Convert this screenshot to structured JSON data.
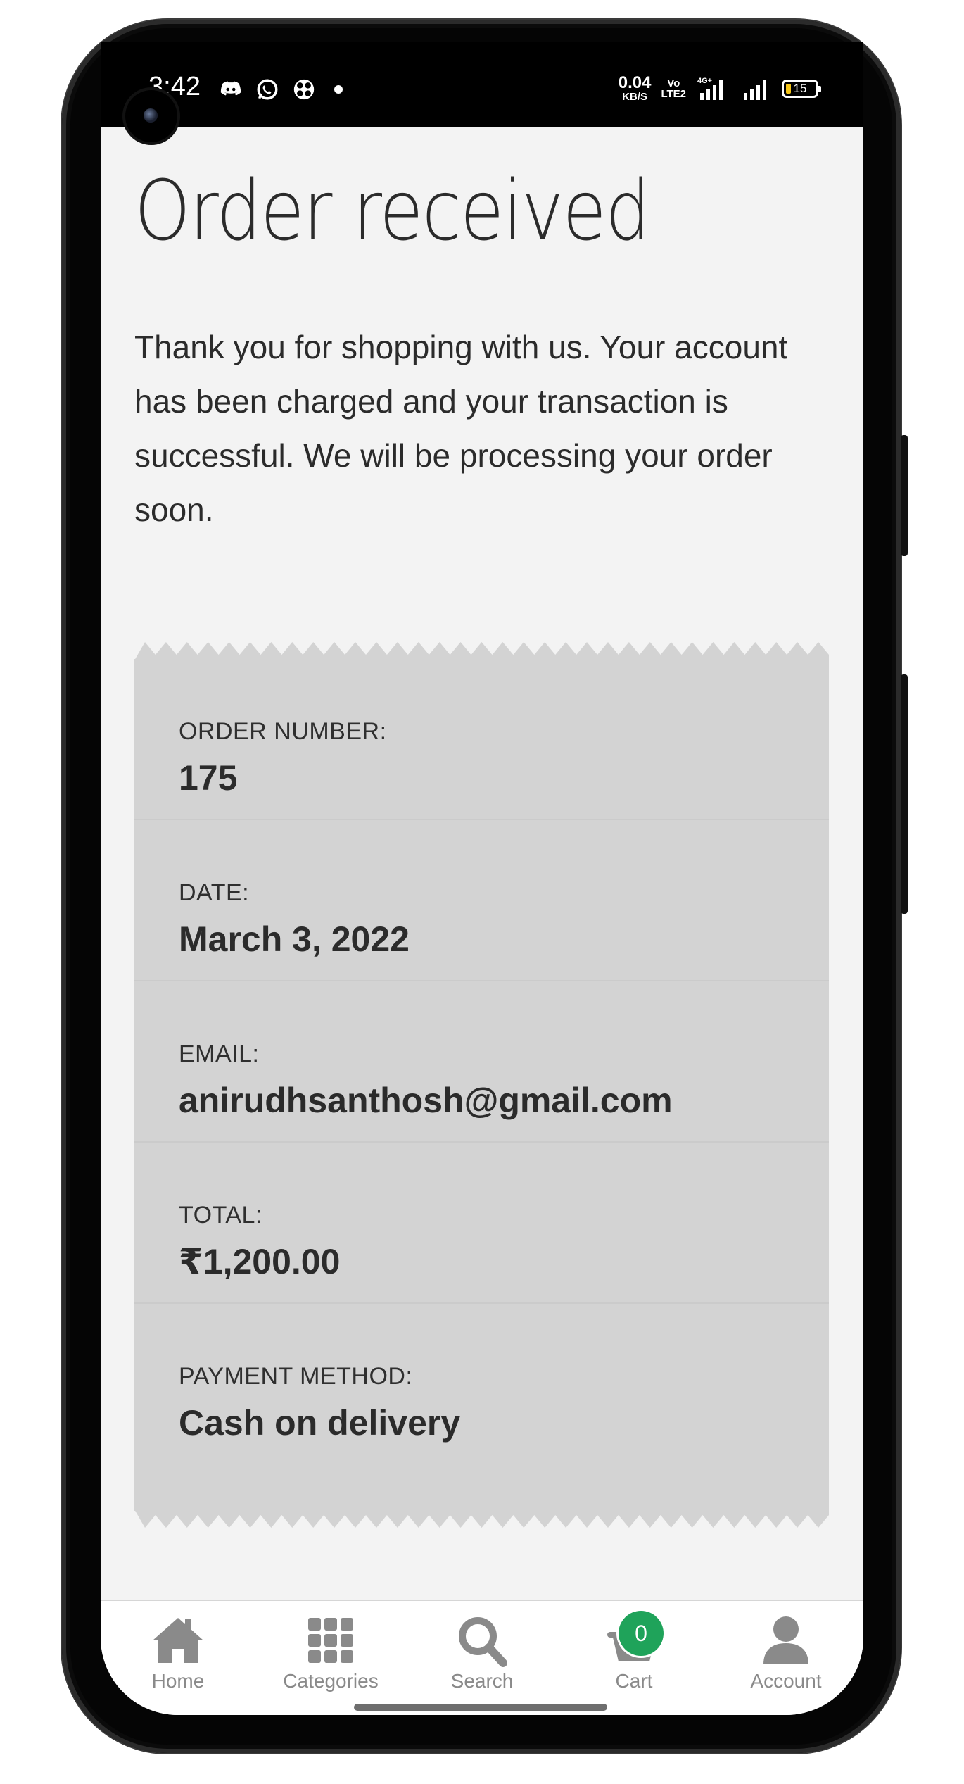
{
  "status_bar": {
    "time": "3:42",
    "speed_value": "0.04",
    "speed_unit": "KB/S",
    "volte_top": "Vo",
    "volte_bottom": "LTE2",
    "network": "4G+",
    "battery": "15",
    "icons_left": [
      "discord-icon",
      "whatsapp-icon",
      "fan-icon",
      "dot-icon"
    ]
  },
  "page": {
    "title": "Order received",
    "message": "Thank you for shopping with us. Your account has been charged and your transaction is successful. We will be processing your order soon."
  },
  "order": {
    "rows": [
      {
        "label": "ORDER NUMBER:",
        "value": "175"
      },
      {
        "label": "DATE:",
        "value": "March 3, 2022"
      },
      {
        "label": "EMAIL:",
        "value": "anirudhsanthosh@gmail.com"
      },
      {
        "label": "TOTAL:",
        "value": "₹1,200.00"
      },
      {
        "label": "PAYMENT METHOD:",
        "value": "Cash on delivery"
      }
    ]
  },
  "bottom_nav": {
    "items": [
      {
        "label": "Home",
        "icon": "home-icon"
      },
      {
        "label": "Categories",
        "icon": "grid-icon"
      },
      {
        "label": "Search",
        "icon": "search-icon"
      },
      {
        "label": "Cart",
        "icon": "basket-icon",
        "badge": "0"
      },
      {
        "label": "Account",
        "icon": "user-icon"
      }
    ]
  },
  "colors": {
    "receipt_bg": "#d3d3d3",
    "page_bg": "#f3f3f3",
    "nav_icon": "#8a8a8a",
    "badge": "#1fa35a"
  }
}
